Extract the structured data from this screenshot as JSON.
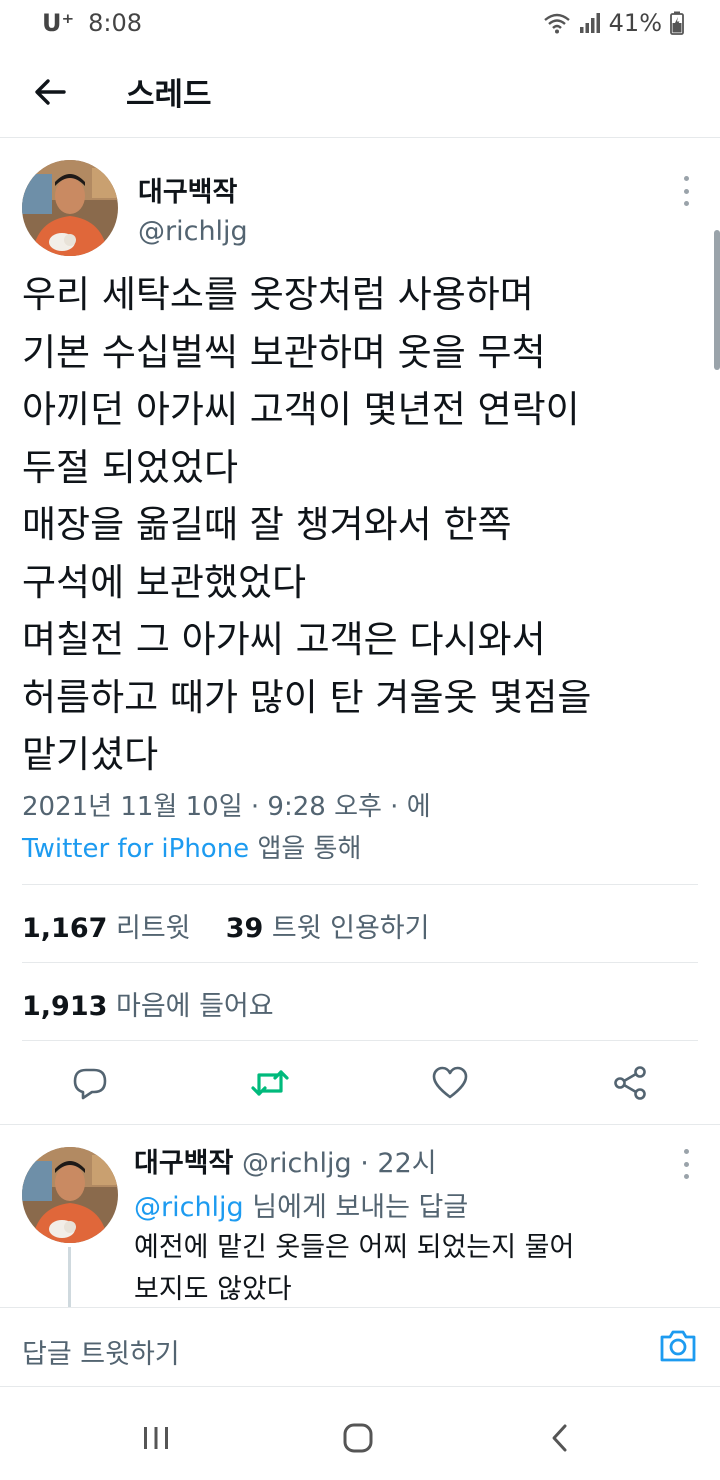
{
  "status_bar": {
    "carrier": "U⁺",
    "time": "8:08",
    "battery": "41%"
  },
  "header": {
    "title": "스레드",
    "back_icon": "arrow-left-icon"
  },
  "tweet": {
    "author_name": "대구백작",
    "author_handle": "@richljg",
    "text": "우리 세탁소를 옷장처럼 사용하며\n기본 수십벌씩 보관하며 옷을 무척\n아끼던 아가씨 고객이 몇년전 연락이\n두절 되었었다\n매장을 옮길때 잘 챙겨와서 한쪽\n구석에 보관했었다\n며칠전 그 아가씨 고객은 다시와서\n허름하고 때가 많이 탄 겨울옷 몇점을\n맡기셨다",
    "timestamp": "2021년 11월 10일 · 9:28 오후 · 에",
    "source_app": "Twitter for iPhone",
    "source_suffix": " 앱을 통해",
    "retweets": "1,167",
    "retweets_label": " 리트윗",
    "quotes": "39",
    "quotes_label": " 트윗 인용하기",
    "likes": "1,913",
    "likes_label": " 마음에 들어요"
  },
  "actions": {
    "reply_icon": "reply-icon",
    "retweet_icon": "retweet-icon",
    "like_icon": "heart-icon",
    "share_icon": "share-icon",
    "retweet_color": "#00ba7c"
  },
  "reply": {
    "author_name": "대구백작",
    "meta": " @richljg · 22시",
    "reply_to_mention": "@richljg",
    "reply_to_suffix": " 님에게 보내는 답글",
    "text": "예전에 맡긴 옷들은 어찌 되었는지 물어\n보지도 않았다"
  },
  "compose": {
    "placeholder": "답글 트윗하기",
    "camera_icon": "camera-icon"
  },
  "nav": {
    "recents_icon": "recents-icon",
    "home_icon": "home-icon",
    "back_icon": "back-chevron-icon"
  },
  "colors": {
    "accent": "#1d9bf0",
    "text": "#0f1419",
    "secondary": "#536471"
  }
}
